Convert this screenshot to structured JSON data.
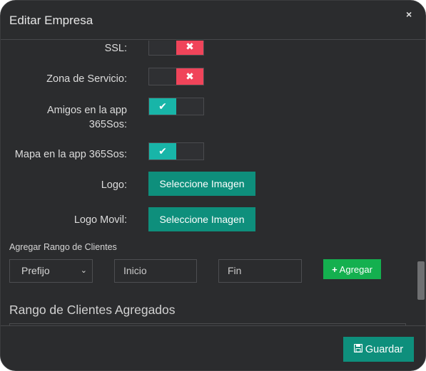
{
  "modal": {
    "title": "Editar Empresa",
    "close_icon": "×"
  },
  "form": {
    "ssl": {
      "label": "SSL:",
      "state": "off",
      "icon": "✖"
    },
    "zona": {
      "label": "Zona de Servicio:",
      "state": "off",
      "icon": "✖"
    },
    "amigos": {
      "label_line1": "Amigos en la app",
      "label_line2": "365Sos:",
      "state": "on",
      "icon": "✔"
    },
    "mapa": {
      "label": "Mapa en la app 365Sos:",
      "state": "on",
      "icon": "✔"
    },
    "logo": {
      "label": "Logo:",
      "button": "Seleccione Imagen"
    },
    "logo_movil": {
      "label": "Logo Movil:",
      "button": "Seleccione Imagen"
    }
  },
  "rango": {
    "section_label": "Agregar Rango de Clientes",
    "prefijo": {
      "value": "Prefijo",
      "chevron": "⌄"
    },
    "inicio_placeholder": "Inicio",
    "fin_placeholder": "Fin",
    "agregar_icon": "+",
    "agregar_label": "Agregar",
    "agregados_title": "Rango de Clientes Agregados"
  },
  "footer": {
    "save_icon": "💾",
    "save_label": "Guardar"
  },
  "colors": {
    "modal_bg": "#2b2c2e",
    "toggle_off": "#f0445a",
    "toggle_on": "#18b5a8",
    "teal_button": "#0e8f7c",
    "green_button": "#14b04f"
  }
}
